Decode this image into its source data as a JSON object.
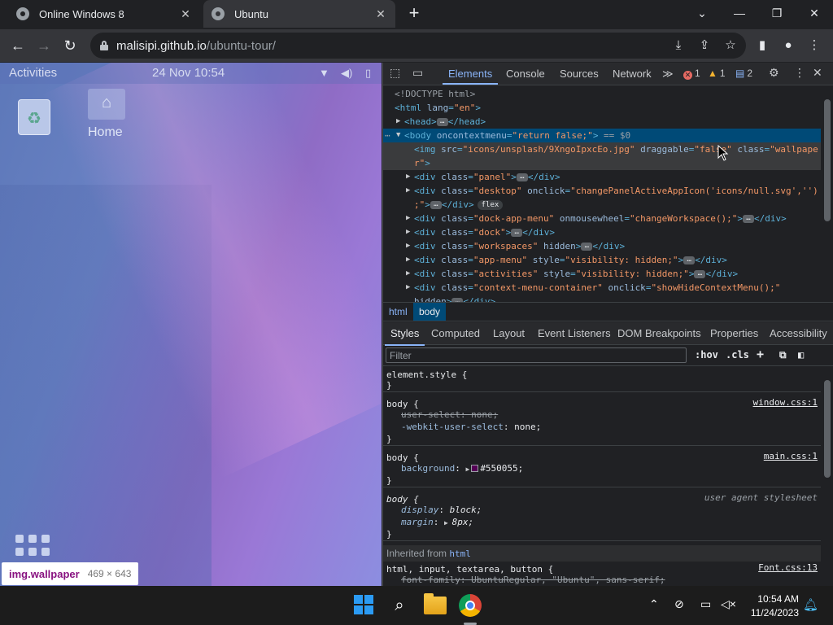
{
  "browser": {
    "tabs": [
      {
        "title": "Online Windows 8",
        "active": false
      },
      {
        "title": "Ubuntu",
        "active": true
      }
    ],
    "new_tab_symbol": "+",
    "close_symbol": "✕",
    "window_controls": {
      "menu": "⌄",
      "minimize": "—",
      "restore": "❐",
      "close": "✕"
    },
    "url_host": "malisipi.github.io",
    "url_path": "/ubuntu-tour/",
    "toolbar_icons": [
      "back-icon",
      "forward-icon",
      "reload-icon",
      "lock-icon",
      "install-icon",
      "share-icon",
      "bookmark-star-icon",
      "side-panel-icon",
      "profile-icon",
      "menu-dots-icon"
    ]
  },
  "ubuntu": {
    "activities": "Activities",
    "clock": "24 Nov 10:54",
    "desktop_icons": [
      {
        "label": "Home"
      }
    ],
    "tooltip": {
      "tag": "img.wallpaper",
      "size": "469 × 643"
    }
  },
  "devtools": {
    "tabs": [
      "Elements",
      "Console",
      "Sources",
      "Network"
    ],
    "more_tabs": "≫",
    "errors": "1",
    "warnings": "1",
    "messages": "2",
    "dom_lines": [
      {
        "indent": 0,
        "parts": [
          {
            "c": "c",
            "t": "<!DOCTYPE html>"
          }
        ]
      },
      {
        "indent": 0,
        "parts": [
          {
            "c": "t",
            "t": "<html "
          },
          {
            "c": "a",
            "t": "lang"
          },
          {
            "c": "t",
            "t": "="
          },
          {
            "c": "v",
            "t": "\"en\""
          },
          {
            "c": "t",
            "t": ">"
          }
        ]
      },
      {
        "indent": 1,
        "arrow": "▶",
        "parts": [
          {
            "c": "t",
            "t": "<head>"
          },
          {
            "c": "ell",
            "t": "…"
          },
          {
            "c": "t",
            "t": "</head>"
          }
        ]
      },
      {
        "indent": 1,
        "arrow": "▼",
        "prefix": "⋯",
        "parts": [
          {
            "c": "t",
            "t": "<body "
          },
          {
            "c": "a",
            "t": "oncontextmenu"
          },
          {
            "c": "t",
            "t": "="
          },
          {
            "c": "v",
            "t": "\"return false;\""
          },
          {
            "c": "t",
            "t": ">"
          },
          {
            "c": "c",
            "t": " == $0"
          }
        ]
      },
      {
        "indent": 2,
        "parts": [
          {
            "c": "t",
            "t": "<img "
          },
          {
            "c": "a",
            "t": "src"
          },
          {
            "c": "t",
            "t": "="
          },
          {
            "c": "v",
            "t": "\"icons/unsplash/9XngoIpxcEo.jpg\""
          },
          {
            "c": "a",
            "t": " draggable"
          },
          {
            "c": "t",
            "t": "="
          },
          {
            "c": "v",
            "t": "\"false\""
          },
          {
            "c": "a",
            "t": " class"
          },
          {
            "c": "t",
            "t": "="
          },
          {
            "c": "v",
            "t": "\"wallpape"
          }
        ]
      },
      {
        "indent": 2,
        "parts": [
          {
            "c": "v",
            "t": "r\""
          },
          {
            "c": "t",
            "t": ">"
          }
        ]
      },
      {
        "indent": 2,
        "arrow": "▶",
        "parts": [
          {
            "c": "t",
            "t": "<div "
          },
          {
            "c": "a",
            "t": "class"
          },
          {
            "c": "t",
            "t": "="
          },
          {
            "c": "v",
            "t": "\"panel\""
          },
          {
            "c": "t",
            "t": ">"
          },
          {
            "c": "ell",
            "t": "…"
          },
          {
            "c": "t",
            "t": "</div>"
          }
        ]
      },
      {
        "indent": 2,
        "arrow": "▶",
        "parts": [
          {
            "c": "t",
            "t": "<div "
          },
          {
            "c": "a",
            "t": "class"
          },
          {
            "c": "t",
            "t": "="
          },
          {
            "c": "v",
            "t": "\"desktop\""
          },
          {
            "c": "a",
            "t": " onclick"
          },
          {
            "c": "t",
            "t": "="
          },
          {
            "c": "v",
            "t": "\"changePanelActiveAppIcon('icons/null.svg','')"
          }
        ]
      },
      {
        "indent": 2,
        "parts": [
          {
            "c": "v",
            "t": ";\""
          },
          {
            "c": "t",
            "t": ">"
          },
          {
            "c": "ell",
            "t": "…"
          },
          {
            "c": "t",
            "t": "</div>"
          },
          {
            "c": "flex",
            "t": "flex"
          }
        ]
      },
      {
        "indent": 2,
        "arrow": "▶",
        "parts": [
          {
            "c": "t",
            "t": "<div "
          },
          {
            "c": "a",
            "t": "class"
          },
          {
            "c": "t",
            "t": "="
          },
          {
            "c": "v",
            "t": "\"dock-app-menu\""
          },
          {
            "c": "a",
            "t": " onmousewheel"
          },
          {
            "c": "t",
            "t": "="
          },
          {
            "c": "v",
            "t": "\"changeWorkspace();\""
          },
          {
            "c": "t",
            "t": ">"
          },
          {
            "c": "ell",
            "t": "…"
          },
          {
            "c": "t",
            "t": "</div>"
          }
        ]
      },
      {
        "indent": 2,
        "arrow": "▶",
        "parts": [
          {
            "c": "t",
            "t": "<div "
          },
          {
            "c": "a",
            "t": "class"
          },
          {
            "c": "t",
            "t": "="
          },
          {
            "c": "v",
            "t": "\"dock\""
          },
          {
            "c": "t",
            "t": ">"
          },
          {
            "c": "ell",
            "t": "…"
          },
          {
            "c": "t",
            "t": "</div>"
          }
        ]
      },
      {
        "indent": 2,
        "arrow": "▶",
        "parts": [
          {
            "c": "t",
            "t": "<div "
          },
          {
            "c": "a",
            "t": "class"
          },
          {
            "c": "t",
            "t": "="
          },
          {
            "c": "v",
            "t": "\"workspaces\""
          },
          {
            "c": "a",
            "t": " hidden"
          },
          {
            "c": "t",
            "t": ">"
          },
          {
            "c": "ell",
            "t": "…"
          },
          {
            "c": "t",
            "t": "</div>"
          }
        ]
      },
      {
        "indent": 2,
        "arrow": "▶",
        "parts": [
          {
            "c": "t",
            "t": "<div "
          },
          {
            "c": "a",
            "t": "class"
          },
          {
            "c": "t",
            "t": "="
          },
          {
            "c": "v",
            "t": "\"app-menu\""
          },
          {
            "c": "a",
            "t": " style"
          },
          {
            "c": "t",
            "t": "="
          },
          {
            "c": "v",
            "t": "\"visibility: hidden;\""
          },
          {
            "c": "t",
            "t": ">"
          },
          {
            "c": "ell",
            "t": "…"
          },
          {
            "c": "t",
            "t": "</div>"
          }
        ]
      },
      {
        "indent": 2,
        "arrow": "▶",
        "parts": [
          {
            "c": "t",
            "t": "<div "
          },
          {
            "c": "a",
            "t": "class"
          },
          {
            "c": "t",
            "t": "="
          },
          {
            "c": "v",
            "t": "\"activities\""
          },
          {
            "c": "a",
            "t": " style"
          },
          {
            "c": "t",
            "t": "="
          },
          {
            "c": "v",
            "t": "\"visibility: hidden;\""
          },
          {
            "c": "t",
            "t": ">"
          },
          {
            "c": "ell",
            "t": "…"
          },
          {
            "c": "t",
            "t": "</div>"
          }
        ]
      },
      {
        "indent": 2,
        "arrow": "▶",
        "parts": [
          {
            "c": "t",
            "t": "<div "
          },
          {
            "c": "a",
            "t": "class"
          },
          {
            "c": "t",
            "t": "="
          },
          {
            "c": "v",
            "t": "\"context-menu-container\""
          },
          {
            "c": "a",
            "t": " onclick"
          },
          {
            "c": "t",
            "t": "="
          },
          {
            "c": "v",
            "t": "\"showHideContextMenu();\""
          }
        ]
      },
      {
        "indent": 2,
        "parts": [
          {
            "c": "a",
            "t": "hidden"
          },
          {
            "c": "t",
            "t": ">"
          },
          {
            "c": "ell",
            "t": "…"
          },
          {
            "c": "t",
            "t": "</div>"
          }
        ]
      }
    ],
    "breadcrumbs": [
      "html",
      "body"
    ],
    "styles_tabs": [
      "Styles",
      "Computed",
      "Layout",
      "Event Listeners",
      "DOM Breakpoints",
      "Properties",
      "Accessibility"
    ],
    "filter_placeholder": "Filter",
    "filter_tools": {
      "hov": ":hov",
      "cls": ".cls",
      "add": "+"
    },
    "rules": [
      {
        "selector": "element.style {",
        "source": "",
        "props": []
      },
      {
        "selector": "body {",
        "source": "window.css:1",
        "props": [
          {
            "name": "user-select",
            "value": "none;",
            "struck": true
          },
          {
            "name": "-webkit-user-select",
            "value": "none;",
            "struck": false
          }
        ]
      },
      {
        "selector": "body {",
        "source": "main.css:1",
        "props": [
          {
            "name": "background",
            "value": "#550055;",
            "struck": false,
            "swatch": "#550055"
          }
        ]
      },
      {
        "selector": "body {",
        "source": "user agent stylesheet",
        "ua": true,
        "props": [
          {
            "name": "display",
            "value": "block;",
            "struck": false
          },
          {
            "name": "margin",
            "value": "8px;",
            "struck": false,
            "expand": true
          }
        ]
      }
    ],
    "inherited_label": "Inherited from",
    "inherited_link": "html",
    "last_rule": {
      "selector": "html, input, textarea, button {",
      "source": "Font.css:13",
      "prop_name": "font-family",
      "prop_value": "UbuntuRegular, \"Ubuntu\", sans-serif;"
    }
  },
  "taskbar": {
    "time": "10:54 AM",
    "date": "11/24/2023"
  }
}
